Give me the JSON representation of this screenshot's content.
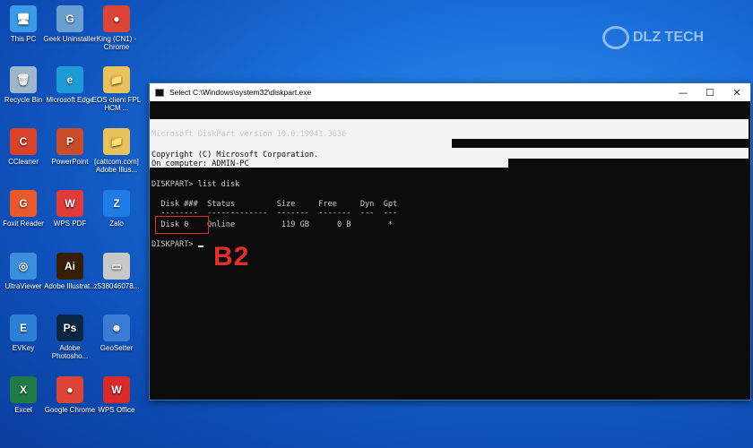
{
  "desktop": {
    "icons": [
      {
        "label": "This PC",
        "icon": "computer-icon",
        "color": "#3b9be8"
      },
      {
        "label": "Geek Uninstaller",
        "icon": "geek-icon",
        "color": "#6aa0d0"
      },
      {
        "label": "King (CN1) - Chrome",
        "icon": "chrome-icon",
        "color": "#db4437"
      },
      {
        "label": "Recycle Bin",
        "icon": "recycle-bin-icon",
        "color": "#9fb7cc"
      },
      {
        "label": "Microsoft Edge",
        "icon": "edge-icon",
        "color": "#1d9bd6"
      },
      {
        "label": "EOS client FPL HCM ...",
        "icon": "folder-icon",
        "color": "#e8c25a"
      },
      {
        "label": "CCleaner",
        "icon": "ccleaner-icon",
        "color": "#d9432b"
      },
      {
        "label": "PowerPoint",
        "icon": "powerpoint-icon",
        "color": "#c94d2a"
      },
      {
        "label": "[cattcom.com] Adobe Illus...",
        "icon": "folder-icon",
        "color": "#e8c25a"
      },
      {
        "label": "Foxit Reader",
        "icon": "foxit-icon",
        "color": "#e85a2b"
      },
      {
        "label": "WPS PDF",
        "icon": "wps-pdf-icon",
        "color": "#e03b3b"
      },
      {
        "label": "Zalo",
        "icon": "zalo-icon",
        "color": "#1f7be6"
      },
      {
        "label": "UltraViewer",
        "icon": "ultraviewer-icon",
        "color": "#3a8edb"
      },
      {
        "label": "Adobe Illustrat...",
        "icon": "illustrator-icon",
        "color": "#3a1d05"
      },
      {
        "label": "z538046078...",
        "icon": "image-file-icon",
        "color": "#c8c8c8"
      },
      {
        "label": "EVKey",
        "icon": "evkey-icon",
        "color": "#2d7fd6"
      },
      {
        "label": "Adobe Photosho...",
        "icon": "photoshop-icon",
        "color": "#0b2545"
      },
      {
        "label": "GeoSetter",
        "icon": "geosetter-icon",
        "color": "#3a7bd5"
      },
      {
        "label": "Excel",
        "icon": "excel-icon",
        "color": "#1f7a45"
      },
      {
        "label": "Google Chrome",
        "icon": "chrome-icon",
        "color": "#db4437"
      },
      {
        "label": "WPS Office",
        "icon": "wps-office-icon",
        "color": "#d92b2b"
      }
    ],
    "icon_glyphs": [
      "🖥",
      "G",
      "●",
      "🗑",
      "e",
      "📁",
      "C",
      "P",
      "📁",
      "G",
      "W",
      "Z",
      "◎",
      "Ai",
      "▭",
      "E",
      "Ps",
      "☻",
      "X",
      "●",
      "W"
    ]
  },
  "watermark": {
    "text": "DLZ TECH"
  },
  "console": {
    "title": "Select C:\\Windows\\system32\\diskpart.exe",
    "controls": {
      "minimize": "—",
      "maximize": "☐",
      "close": "✕"
    },
    "lines": {
      "version": "Microsoft DiskPart version 10.0.19041.3636",
      "copyright": "Copyright (C) Microsoft Corporation.",
      "computer": "On computer: ADMIN-PC",
      "command": "DISKPART> list disk",
      "header": "  Disk ###  Status         Size     Free     Dyn  Gpt",
      "separator": "  --------  -------------  -------  -------  ---  ---",
      "row": "  Disk 0    Online          119 GB      0 B        *",
      "prompt": "DISKPART> "
    }
  },
  "annotation": {
    "step": "B2",
    "box_color": "#e22a2a"
  }
}
